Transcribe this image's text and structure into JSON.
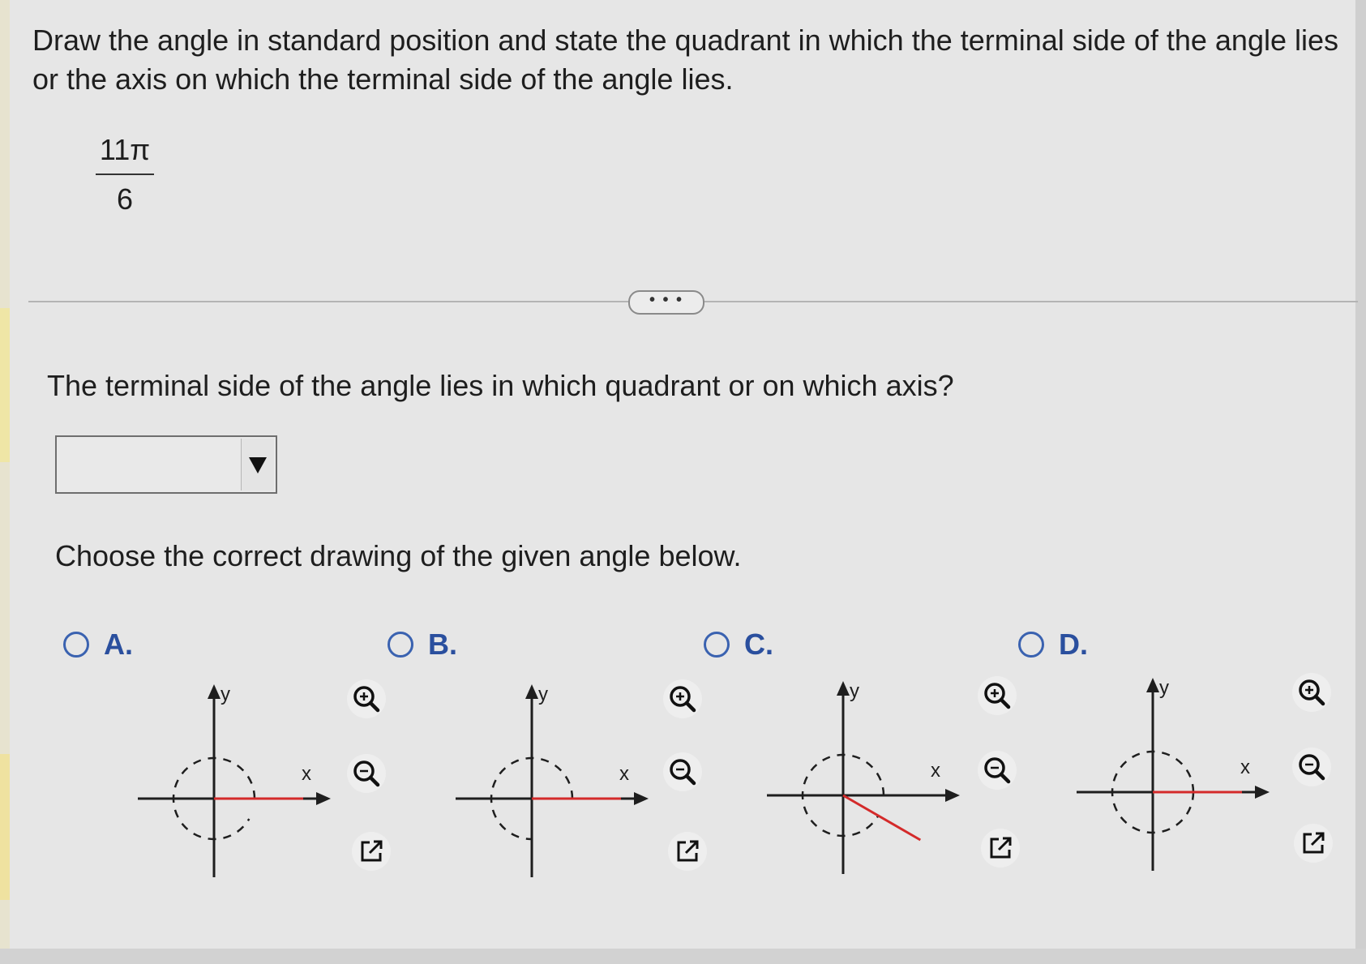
{
  "question": "Draw the angle in standard position and state the quadrant in which the terminal side of the angle lies or the axis on which the terminal side of the angle lies.",
  "angle": {
    "numerator": "11π",
    "denominator": "6"
  },
  "more_button": "• • •",
  "sub_question": "The terminal side of the angle lies in which quadrant or on which axis?",
  "dropdown": {
    "value": "",
    "icon": "triangle-down-icon"
  },
  "instruction": "Choose the correct drawing of the given angle below.",
  "axis_labels": {
    "x": "x",
    "y": "y"
  },
  "options": [
    {
      "letter": "A.",
      "terminal_angle_deg": 0,
      "arc_from_deg": 0,
      "arc_to_deg": 330,
      "terminal_color": "#d42a2a"
    },
    {
      "letter": "B.",
      "terminal_angle_deg": 0,
      "arc_from_deg": 0,
      "arc_to_deg": 270,
      "terminal_color": "#d42a2a"
    },
    {
      "letter": "C.",
      "terminal_angle_deg": -30,
      "arc_from_deg": 0,
      "arc_to_deg": 330,
      "terminal_color": "#d42a2a"
    },
    {
      "letter": "D.",
      "terminal_angle_deg": 0,
      "arc_from_deg": 0,
      "arc_to_deg": 360,
      "terminal_color": "#d42a2a"
    }
  ],
  "tools": [
    "zoom-in-icon",
    "zoom-out-icon",
    "open-new-window-icon"
  ],
  "colors": {
    "accent": "#2a4f9e",
    "radio": "#3a62b0",
    "terminal": "#d42a2a"
  }
}
